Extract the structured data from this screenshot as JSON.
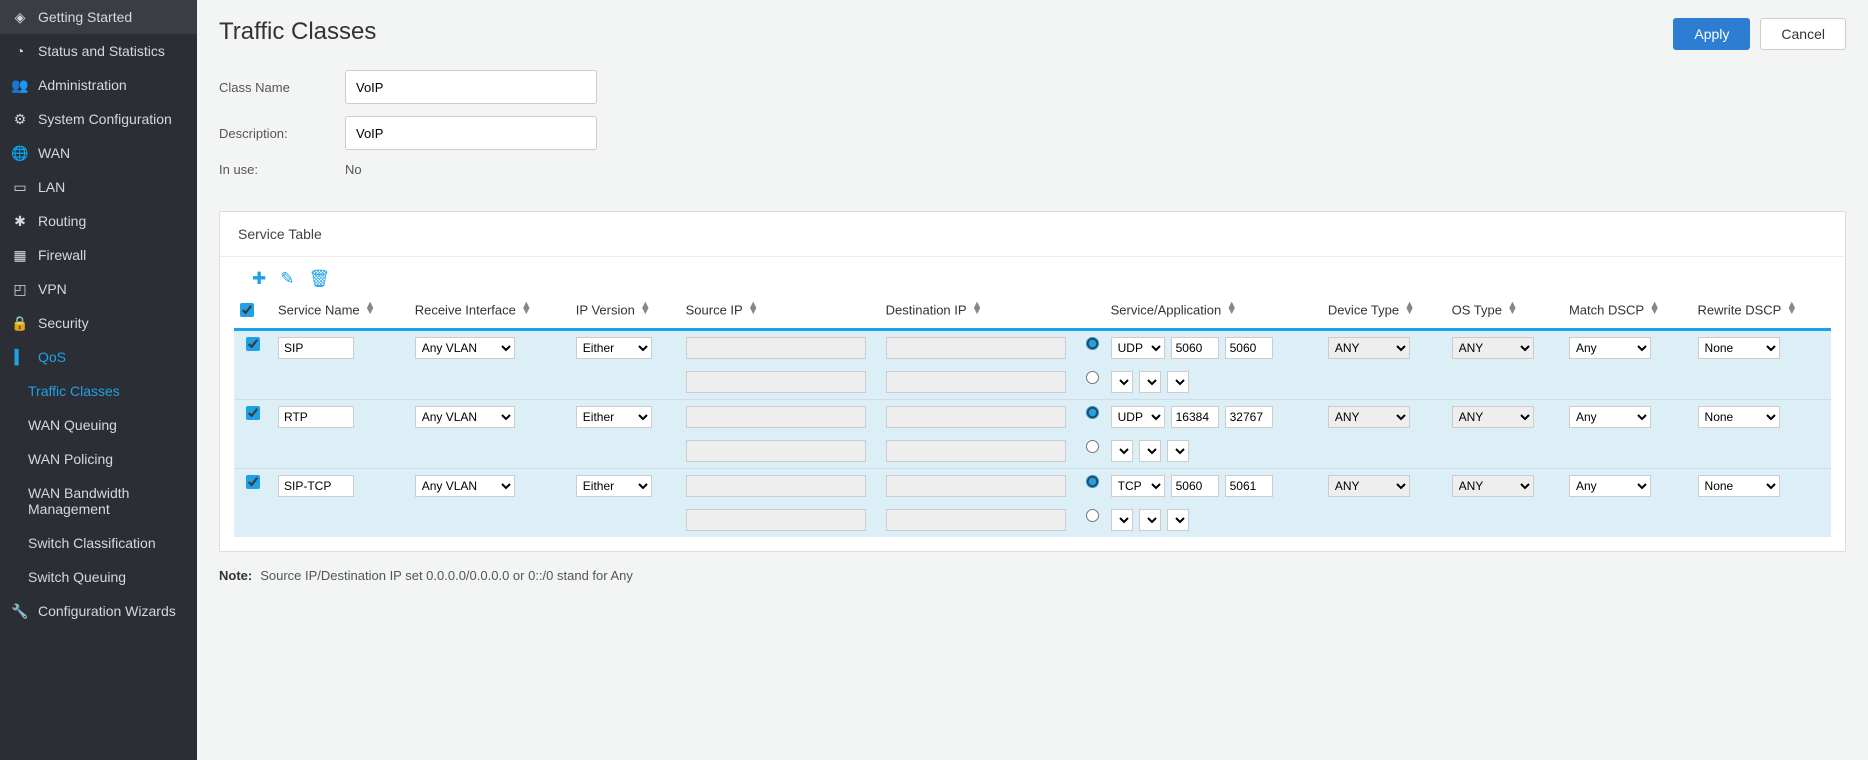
{
  "sidebar": {
    "items": [
      {
        "label": "Getting Started",
        "icon": "◈"
      },
      {
        "label": "Status and Statistics",
        "icon": "◔"
      },
      {
        "label": "Administration",
        "icon": "👥"
      },
      {
        "label": "System Configuration",
        "icon": "⚙"
      },
      {
        "label": "WAN",
        "icon": "🌐"
      },
      {
        "label": "LAN",
        "icon": "▭"
      },
      {
        "label": "Routing",
        "icon": "✱"
      },
      {
        "label": "Firewall",
        "icon": "▦"
      },
      {
        "label": "VPN",
        "icon": "◰"
      },
      {
        "label": "Security",
        "icon": "🔒"
      },
      {
        "label": "QoS",
        "icon": "▍",
        "active": true
      },
      {
        "label": "Configuration Wizards",
        "icon": "🔧"
      }
    ],
    "qos_sub": [
      {
        "label": "Traffic Classes",
        "active": true
      },
      {
        "label": "WAN Queuing"
      },
      {
        "label": "WAN Policing"
      },
      {
        "label": "WAN Bandwidth Management"
      },
      {
        "label": "Switch Classification"
      },
      {
        "label": "Switch Queuing"
      }
    ]
  },
  "page": {
    "title": "Traffic Classes",
    "apply": "Apply",
    "cancel": "Cancel"
  },
  "form": {
    "class_name_label": "Class Name",
    "class_name_value": "VoIP",
    "description_label": "Description:",
    "description_value": "VoIP",
    "inuse_label": "In use:",
    "inuse_value": "No"
  },
  "panel": {
    "title": "Service Table"
  },
  "table": {
    "headers": {
      "service_name": "Service Name",
      "receive_interface": "Receive Interface",
      "ip_version": "IP Version",
      "source_ip": "Source IP",
      "destination_ip": "Destination IP",
      "service_app": "Service/Application",
      "device_type": "Device Type",
      "os_type": "OS Type",
      "match_dscp": "Match DSCP",
      "rewrite_dscp": "Rewrite DSCP"
    },
    "rows": [
      {
        "checked": true,
        "name": "SIP",
        "recv": "Any VLAN",
        "ipver": "Either",
        "proto": "UDP",
        "port_from": "5060",
        "port_to": "5060",
        "device": "ANY",
        "os": "ANY",
        "match": "Any",
        "rewrite": "None"
      },
      {
        "checked": true,
        "name": "RTP",
        "recv": "Any VLAN",
        "ipver": "Either",
        "proto": "UDP",
        "port_from": "16384",
        "port_to": "32767",
        "device": "ANY",
        "os": "ANY",
        "match": "Any",
        "rewrite": "None"
      },
      {
        "checked": true,
        "name": "SIP-TCP",
        "recv": "Any VLAN",
        "ipver": "Either",
        "proto": "TCP",
        "port_from": "5060",
        "port_to": "5061",
        "device": "ANY",
        "os": "ANY",
        "match": "Any",
        "rewrite": "None"
      }
    ]
  },
  "note": {
    "prefix": "Note:",
    "text": "Source IP/Destination IP set 0.0.0.0/0.0.0.0 or 0::/0 stand for Any"
  }
}
